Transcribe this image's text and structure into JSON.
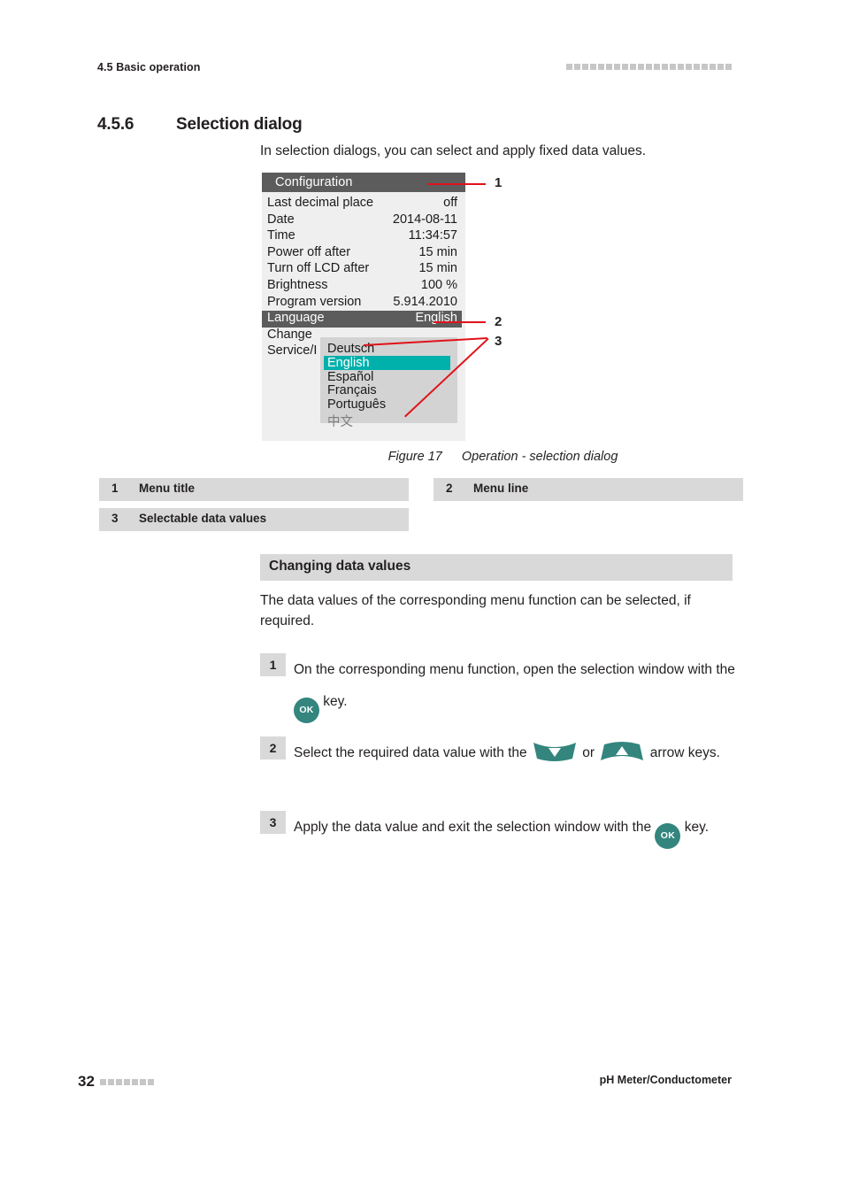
{
  "header": {
    "running_head": "4.5 Basic operation",
    "marker_count": 21
  },
  "section": {
    "number": "4.5.6",
    "title": "Selection dialog",
    "intro": "In selection dialogs, you can select and apply fixed data values."
  },
  "lcd": {
    "title": "Configuration",
    "rows": [
      {
        "label": "Last decimal place",
        "value": "off",
        "selected": false
      },
      {
        "label": "Date",
        "value": "2014-08-11",
        "selected": false
      },
      {
        "label": "Time",
        "value": "11:34:57",
        "selected": false
      },
      {
        "label": "Power off after",
        "value": "15 min",
        "selected": false
      },
      {
        "label": "Turn off LCD after",
        "value": "15 min",
        "selected": false
      },
      {
        "label": "Brightness",
        "value": "100 %",
        "selected": false
      },
      {
        "label": "Program version",
        "value": "5.914.2010",
        "selected": false
      },
      {
        "label": "Language",
        "value": "English",
        "selected": true
      },
      {
        "label": "Change",
        "value": "",
        "selected": false
      },
      {
        "label": "Service/I",
        "value": "",
        "selected": false
      }
    ],
    "dropdown": {
      "items": [
        {
          "label": "Deutsch",
          "highlight": false,
          "dim": false
        },
        {
          "label": "English",
          "highlight": true,
          "dim": false
        },
        {
          "label": "Español",
          "highlight": false,
          "dim": false
        },
        {
          "label": "Français",
          "highlight": false,
          "dim": false
        },
        {
          "label": "Português",
          "highlight": false,
          "dim": false
        },
        {
          "label": "中文",
          "highlight": false,
          "dim": true
        }
      ]
    },
    "callouts": [
      {
        "id": "1",
        "target": "menu-title"
      },
      {
        "id": "2",
        "target": "menu-line"
      },
      {
        "id": "3",
        "target": "selectable-data-values"
      }
    ],
    "colors": {
      "screen_background": "#efefef",
      "titlebar": "#5c5c5c",
      "selected_row": "#5c5c5c",
      "dropdown_background": "#d3d3d3",
      "highlight": "#00b0ab",
      "leader_line": "#e1121a"
    }
  },
  "figure": {
    "label": "Figure 17",
    "caption": "Operation - selection dialog"
  },
  "legend": [
    {
      "num": "1",
      "text": "Menu title"
    },
    {
      "num": "2",
      "text": "Menu line"
    },
    {
      "num": "3",
      "text": "Selectable data values"
    }
  ],
  "subsection": {
    "heading": "Changing data values",
    "paragraph": "The data values of the corresponding menu function can be selected, if required."
  },
  "steps": [
    {
      "num": "1",
      "part1": "On the corresponding menu function, open the selection window with the",
      "key1": "OK",
      "part2": "key.",
      "key2": null,
      "part3": null
    },
    {
      "num": "2",
      "part1": "Select the required data value with the",
      "key1": "arrow-down",
      "part2": "or",
      "key2": "arrow-up",
      "part3": "arrow keys."
    },
    {
      "num": "3",
      "part1": "Apply the data value and exit the selection window with the",
      "key1": "OK",
      "part2": "key.",
      "key2": null,
      "part3": null
    }
  ],
  "keys": {
    "ok_label": "OK",
    "ok_color": "#33857e",
    "arrow_color": "#33857e"
  },
  "footer": {
    "page_number": "32",
    "marker_count": 7,
    "product": "pH Meter/Conductometer"
  }
}
